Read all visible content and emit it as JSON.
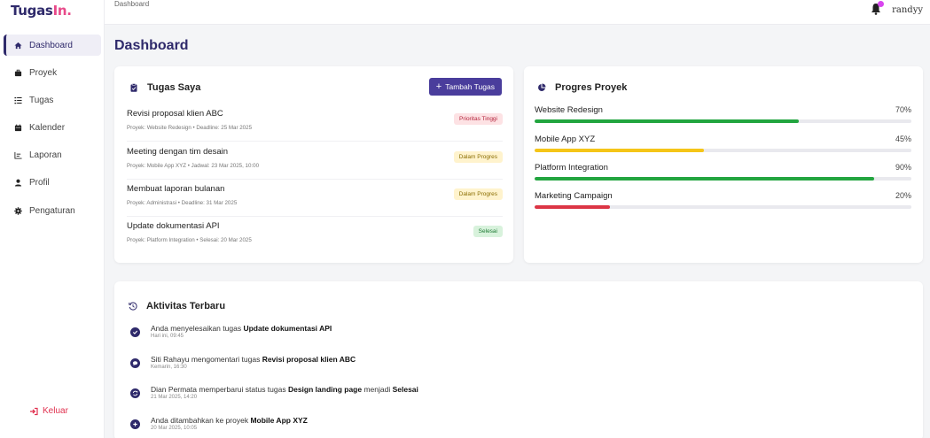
{
  "app": {
    "logo_main": "Tugas",
    "logo_accent": "In."
  },
  "breadcrumb": "Dashboard",
  "user": {
    "name": "randyy"
  },
  "sidebar": {
    "items": [
      {
        "label": "Dashboard",
        "icon": "home-icon",
        "active": true
      },
      {
        "label": "Proyek",
        "icon": "briefcase-icon"
      },
      {
        "label": "Tugas",
        "icon": "list-icon"
      },
      {
        "label": "Kalender",
        "icon": "calendar-icon"
      },
      {
        "label": "Laporan",
        "icon": "chart-icon"
      },
      {
        "label": "Profil",
        "icon": "user-icon"
      },
      {
        "label": "Pengaturan",
        "icon": "gear-icon"
      }
    ],
    "logout_label": "Keluar"
  },
  "page_title": "Dashboard",
  "tasks": {
    "title": "Tugas Saya",
    "add_button": "Tambah Tugas",
    "items": [
      {
        "title": "Revisi proposal klien ABC",
        "meta": "Proyek: Website Redesign • Deadline: 25 Mar 2025",
        "badge": "Prioritas Tinggi",
        "badge_type": "red"
      },
      {
        "title": "Meeting dengan tim desain",
        "meta": "Proyek: Mobile App XYZ • Jadwal: 23 Mar 2025, 10:00",
        "badge": "Dalam Progres",
        "badge_type": "yellow"
      },
      {
        "title": "Membuat laporan bulanan",
        "meta": "Proyek: Administrasi • Deadline: 31 Mar 2025",
        "badge": "Dalam Progres",
        "badge_type": "yellow"
      },
      {
        "title": "Update dokumentasi API",
        "meta": "Proyek: Platform Integration • Selesai: 20 Mar 2025",
        "badge": "Selesai",
        "badge_type": "green"
      }
    ]
  },
  "progress": {
    "title": "Progres Proyek",
    "items": [
      {
        "name": "Website Redesign",
        "percent_label": "70%",
        "percent": 70,
        "color": "#22a53f"
      },
      {
        "name": "Mobile App XYZ",
        "percent_label": "45%",
        "percent": 45,
        "color": "#f5c518"
      },
      {
        "name": "Platform Integration",
        "percent_label": "90%",
        "percent": 90,
        "color": "#22a53f"
      },
      {
        "name": "Marketing Campaign",
        "percent_label": "20%",
        "percent": 20,
        "color": "#dc3545"
      }
    ]
  },
  "activity": {
    "title": "Aktivitas Terbaru",
    "items": [
      {
        "icon": "check-icon",
        "prefix": "Anda menyelesaikan tugas ",
        "bold": "Update dokumentasi API",
        "suffix": "",
        "bold2": "",
        "time": "Hari ini, 09:45"
      },
      {
        "icon": "comment-icon",
        "prefix": "Siti Rahayu mengomentari tugas ",
        "bold": "Revisi proposal klien ABC",
        "suffix": "",
        "bold2": "",
        "time": "Kemarin, 16:30"
      },
      {
        "icon": "sync-icon",
        "prefix": "Dian Permata memperbarui status tugas ",
        "bold": "Design landing page",
        "suffix": " menjadi ",
        "bold2": "Selesai",
        "time": "21 Mar 2025, 14:20"
      },
      {
        "icon": "plus-icon",
        "prefix": "Anda ditambahkan ke proyek ",
        "bold": "Mobile App XYZ",
        "suffix": "",
        "bold2": "",
        "time": "20 Mar 2025, 10:05"
      }
    ]
  }
}
